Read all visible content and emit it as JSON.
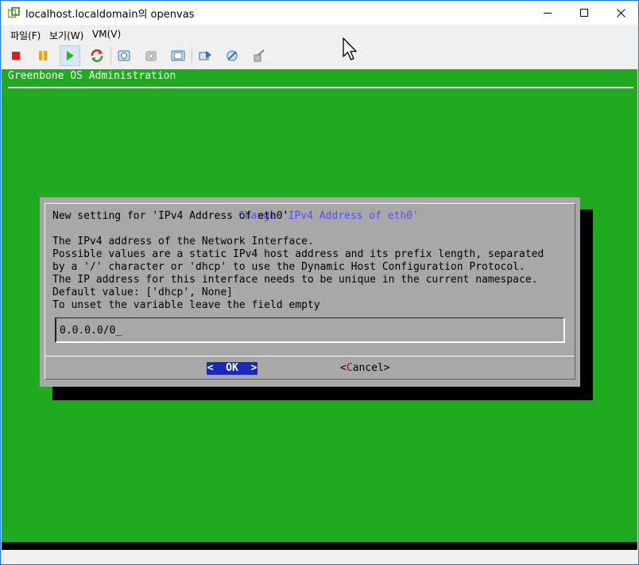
{
  "window": {
    "title": "localhost.localdomain의 openvas",
    "icons": [
      "vmware-app-icon",
      "minimize-icon",
      "maximize-icon",
      "close-icon"
    ]
  },
  "menu": {
    "items": [
      "파일(F)",
      "보기(W)",
      "VM(V)"
    ]
  },
  "toolbar": {
    "buttons": [
      "stop-icon",
      "pause-icon",
      "play-icon",
      "reset-icon",
      "snapshot-icon",
      "revert-snapshot-icon",
      "manage-snapshots-icon",
      "send-ctrl-alt-del-icon",
      "settings-icon",
      "connect-icon"
    ]
  },
  "console": {
    "header": "Greenbone OS Administration",
    "dialog": {
      "title": "Change 'IPv4 Address of eth0'",
      "lines": [
        "New setting for 'IPv4 Address of eth0'",
        "",
        "The IPv4 address of the Network Interface.",
        "Possible values are a static IPv4 host address and its prefix length, separated",
        "by a '/' character or 'dhcp' to use the Dynamic Host Configuration Protocol.",
        "The IP address for this interface needs to be unique in the current namespace.",
        "Default value: ['dhcp', None]",
        "To unset the variable leave the field empty"
      ],
      "input_value": "0.0.0.0/0_",
      "ok_label": "<  OK  >",
      "cancel_prefix": "<",
      "cancel_hotkey": "C",
      "cancel_rest": "ancel>"
    }
  },
  "colors": {
    "console_bg": "#1faa1f",
    "dialog_bg": "#a8a8a8",
    "dialog_title": "#4f4fff",
    "ok_button_bg": "#1a2ab8",
    "hotkey": "#c00000"
  }
}
